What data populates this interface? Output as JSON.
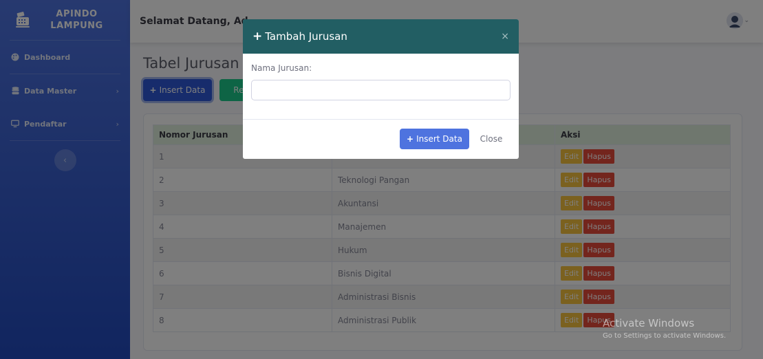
{
  "sidebar": {
    "brand_line1": "APINDO",
    "brand_line2": "LAMPUNG",
    "brand_icon": "cash-register-icon",
    "items": [
      {
        "label": "Dashboard",
        "icon": "palette-icon"
      },
      {
        "label": "Data Master",
        "icon": "database-icon"
      },
      {
        "label": "Pendaftar",
        "icon": "desktop-icon"
      }
    ],
    "toggle_icon": "chevron-left-icon"
  },
  "topbar": {
    "welcome": "Selamat Datang, Ad"
  },
  "page": {
    "title": "Tabel Jurusan",
    "insert_label": "Insert Data",
    "refresh_label": "Ref"
  },
  "table": {
    "headers": [
      "Nomor Jurusan",
      "",
      "Aksi"
    ],
    "edit_label": "Edit",
    "delete_label": "Hapus",
    "rows": [
      {
        "no": "1",
        "name": ""
      },
      {
        "no": "2",
        "name": "Teknologi Pangan"
      },
      {
        "no": "3",
        "name": "Akuntansi"
      },
      {
        "no": "4",
        "name": "Manajemen"
      },
      {
        "no": "5",
        "name": "Hukum"
      },
      {
        "no": "6",
        "name": "Bisnis Digital"
      },
      {
        "no": "7",
        "name": "Administrasi Bisnis"
      },
      {
        "no": "8",
        "name": "Administrasi Publik"
      }
    ]
  },
  "modal": {
    "title": "Tambah Jurusan",
    "close_glyph": "×",
    "field_label": "Nama Jurusan:",
    "field_value": "",
    "insert_label": "Insert Data",
    "close_label": "Close"
  },
  "watermark": {
    "line1": "Activate Windows",
    "line2": "Go to Settings to activate Windows."
  },
  "colors": {
    "sidebar": "#4e73df",
    "modal_header": "#225e63",
    "primary": "#4e73df",
    "success": "#1cc88a",
    "warning": "#f6c23e",
    "danger": "#e74a3b"
  }
}
